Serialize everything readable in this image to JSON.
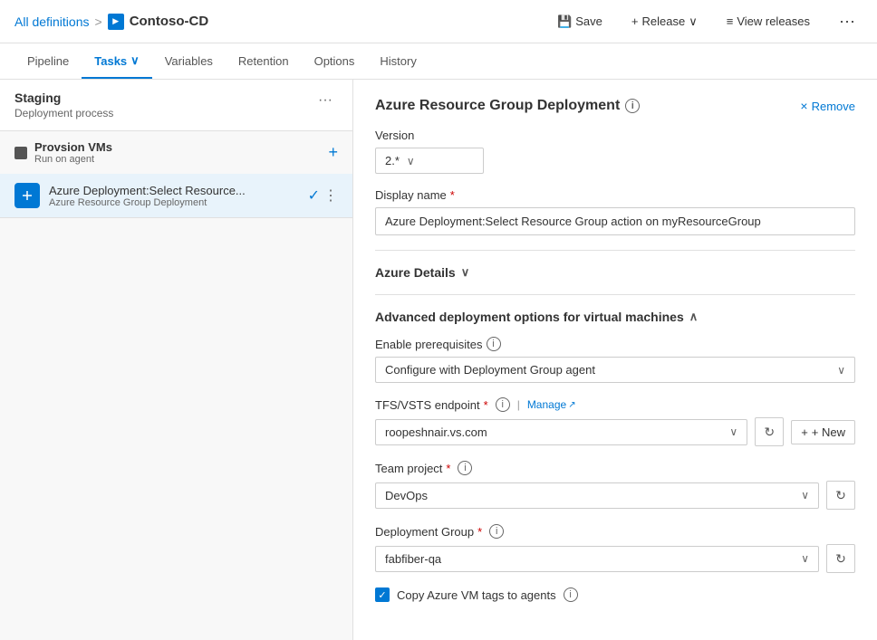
{
  "breadcrumb": {
    "all_definitions": "All definitions",
    "separator": ">",
    "pipeline_icon": "CD",
    "pipeline_name": "Contoso-CD"
  },
  "top_actions": {
    "save": "Save",
    "release": "Release",
    "view_releases": "View releases"
  },
  "nav": {
    "tabs": [
      {
        "id": "pipeline",
        "label": "Pipeline"
      },
      {
        "id": "tasks",
        "label": "Tasks",
        "hasDropdown": true,
        "active": true
      },
      {
        "id": "variables",
        "label": "Variables"
      },
      {
        "id": "retention",
        "label": "Retention"
      },
      {
        "id": "options",
        "label": "Options"
      },
      {
        "id": "history",
        "label": "History"
      }
    ]
  },
  "left_panel": {
    "stage": {
      "name": "Staging",
      "subtitle": "Deployment process"
    },
    "phase": {
      "name": "Provsion VMs",
      "subtitle": "Run on agent"
    },
    "task": {
      "name": "Azure Deployment:Select Resource...",
      "subtitle": "Azure Resource Group Deployment"
    }
  },
  "right_panel": {
    "title": "Azure Resource Group Deployment",
    "remove_label": "Remove",
    "version_label": "Version",
    "version_value": "2.*",
    "display_name_label": "Display name",
    "required_marker": "*",
    "display_name_value": "Azure Deployment:Select Resource Group action on myResourceGroup",
    "azure_details_section": "Azure Details",
    "advanced_section": "Advanced deployment options for virtual machines",
    "enable_prereq_label": "Enable prerequisites",
    "enable_prereq_value": "Configure with Deployment Group agent",
    "tfs_endpoint_label": "TFS/VSTS endpoint",
    "manage_label": "Manage",
    "tfs_endpoint_value": "roopeshnair.vs.com",
    "new_label": "+ New",
    "team_project_label": "Team project",
    "team_project_value": "DevOps",
    "deployment_group_label": "Deployment Group",
    "deployment_group_value": "fabfiber-qa",
    "copy_tags_label": "Copy Azure VM tags to agents"
  },
  "icons": {
    "save": "💾",
    "plus": "+",
    "chevron_down": "⌄",
    "chevron_up": "∧",
    "info": "i",
    "close": "×",
    "refresh": "↻",
    "external_link": "↗",
    "check": "✓",
    "more": "⋮",
    "pipe_separator": "|"
  }
}
